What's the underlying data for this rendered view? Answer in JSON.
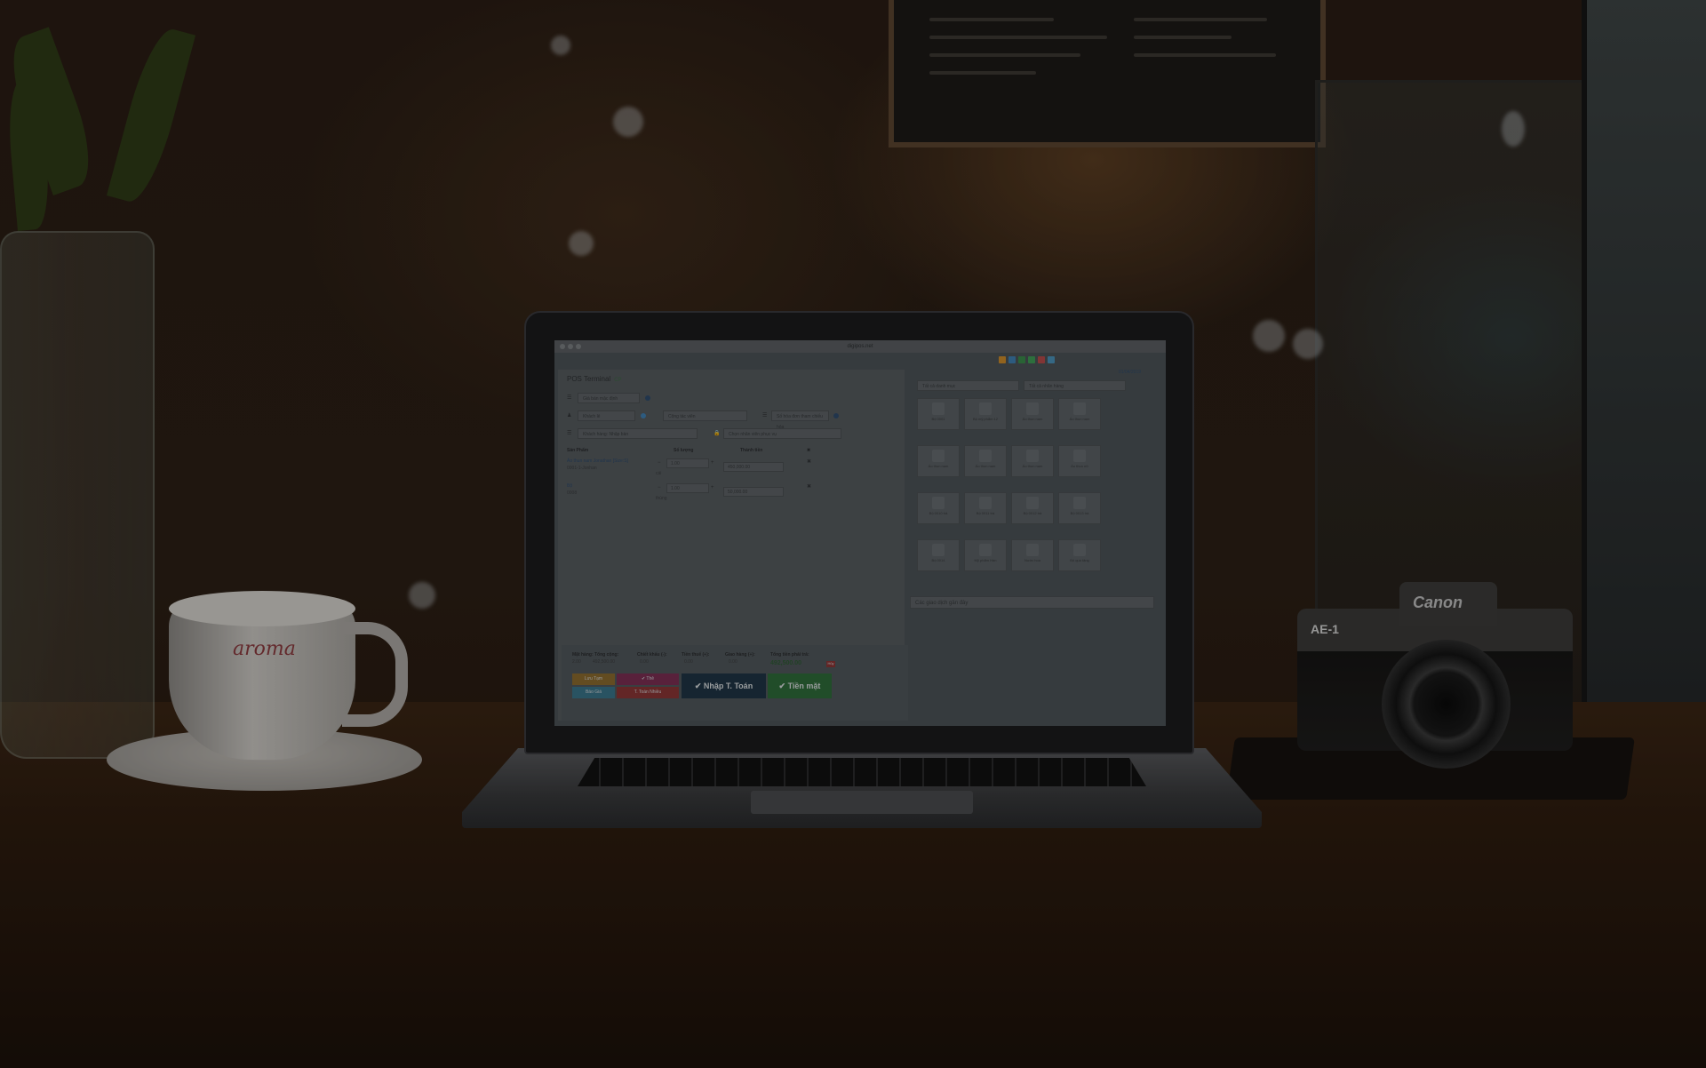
{
  "browser": {
    "url": "digipos.net"
  },
  "pos": {
    "title": "POS Terminal",
    "title_badge": "CP",
    "price_list": "Giá bán mặc định",
    "customer": "Khách lẻ",
    "staff": "Cộng tác viên",
    "invoice_placeholder": "Số hóa đơn tham chiếu hóa",
    "sale_type": "Khách hàng: Nhập bàn",
    "service_staff_placeholder": "Chọn nhân viên phục vụ",
    "table_headers": {
      "product": "Sản Phẩm",
      "qty": "Số lượng",
      "amount": "Thành tiền",
      "remove": "✖"
    },
    "lines": [
      {
        "name": "Áo thun nam Jonathan [Size:S]",
        "sku": "0001-1-Jonhan",
        "qty": "1.00",
        "unit": "cái",
        "amount": "450,000.00"
      },
      {
        "name": "Bộ",
        "sku": "0008",
        "qty": "1.00",
        "unit": "thùng",
        "amount": "50,000.00"
      }
    ],
    "totals": {
      "items_label": "Mặt hàng: Tổng cộng:",
      "items_value": "2.00",
      "subtotal_value": "492,500.00",
      "discount_label": "Chiết khấu (-):",
      "discount_value": "0.00",
      "tax_label": "Tiền thuế (+):",
      "tax_value": "0.00",
      "shipping_label": "Giao hàng (+):",
      "shipping_value": "0.00",
      "grand_label": "Tổng tiền phải trả:",
      "grand_value": "492,500.00",
      "cancel": "Hủy"
    },
    "buttons": {
      "draft": "Lưu Tạm",
      "quote": "Báo Giá",
      "card": "✔ Thẻ",
      "multi_pay": "T. Toán Nhiều",
      "pay_multi_big": "✔ Nhập T. Toán",
      "cash": "✔ Tiền mặt"
    }
  },
  "right": {
    "date": "01/04/2019",
    "category_select": "Tất cả danh mục",
    "brand_select": "Tất cả nhãn hàng",
    "recent_title": "Các giao dịch gần đây",
    "products": [
      "Bộ 0001",
      "Bộ mỹ phẩm 12",
      "Áo thun nam",
      "Áo thun nam",
      "Áo thun nam",
      "Áo thun nam",
      "Áo thun nam",
      "Áo thun nữ",
      "Bộ 0010 trà",
      "Bộ 0011 trà",
      "Bộ 0012 trà",
      "Bộ 0013 trà",
      "Bộ 0014",
      "Mỹ phẩm Hàn",
      "Nước hoa",
      "Bộ quà tặng"
    ],
    "toolbar_colors": [
      "#c98a2a",
      "#3f7fb0",
      "#3a8a4a",
      "#3f9a55",
      "#b44a4a",
      "#4a90b8"
    ]
  },
  "scene": {
    "cup_brand": "aroma",
    "camera_brand": "Canon",
    "camera_model": "AE-1"
  }
}
